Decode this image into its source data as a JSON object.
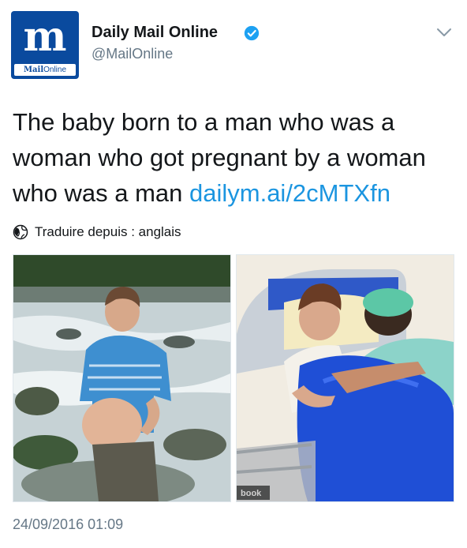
{
  "author": {
    "display_name": "Daily Mail Online",
    "handle": "@MailOnline",
    "avatar_monogram": "m",
    "avatar_wordmark_bold": "Mail",
    "avatar_wordmark_light": "Online",
    "verified": true
  },
  "tweet": {
    "text": "The baby born to a man who was a woman who got pregnant by a woman who was a man ",
    "link_text": "dailym.ai/2cMTXfn",
    "translate_label": "Traduire depuis : anglais",
    "timestamp": "24/09/2016 01:09"
  },
  "media": {
    "photo_watermark": "book"
  },
  "icons": {
    "verified": "verified-badge-icon",
    "menu": "chevron-down-icon",
    "translate": "globe-icon"
  },
  "colors": {
    "link": "#1b95e0",
    "verified": "#1da1f2",
    "secondary_text": "#657786",
    "brand": "#0a4a9e"
  }
}
